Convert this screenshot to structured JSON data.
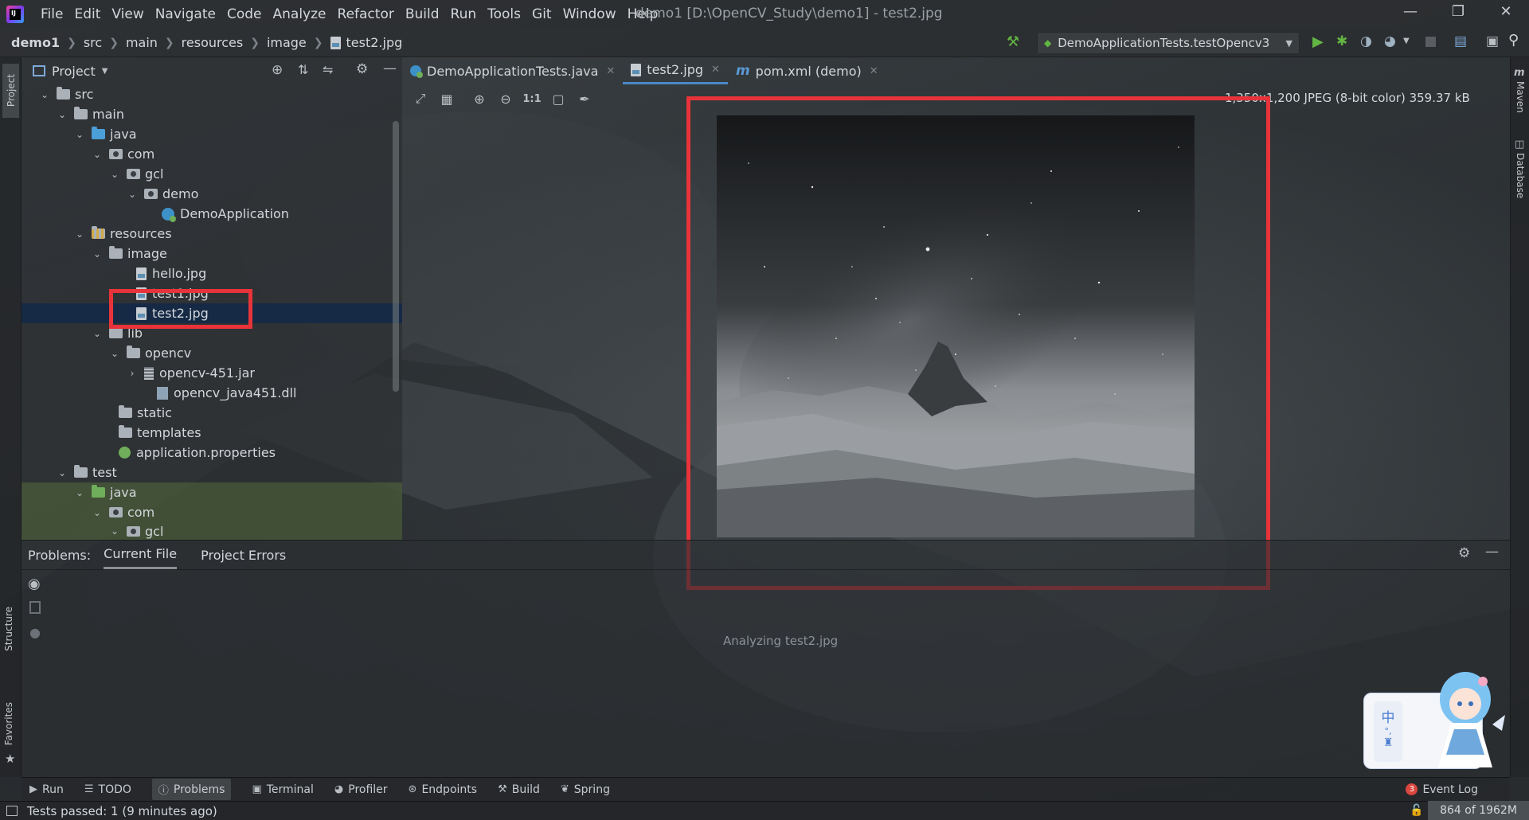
{
  "menubar": {
    "app_icon": "intellij-logo",
    "items": [
      "File",
      "Edit",
      "View",
      "Navigate",
      "Code",
      "Analyze",
      "Refactor",
      "Build",
      "Run",
      "Tools",
      "Git",
      "Window",
      "Help"
    ],
    "title": "demo1 [D:\\OpenCV_Study\\demo1] - test2.jpg"
  },
  "navbar": {
    "crumbs": [
      "demo1",
      "src",
      "main",
      "resources",
      "image",
      "test2.jpg"
    ],
    "run_config": "DemoApplicationTests.testOpencv3"
  },
  "left_stripe": {
    "project": "Project",
    "structure": "Structure",
    "favorites": "Favorites"
  },
  "right_stripe": {
    "maven": "Maven",
    "database": "Database"
  },
  "project_panel": {
    "title": "Project",
    "tree": [
      {
        "label": "src",
        "depth": 1,
        "expanded": true,
        "icon": "folder"
      },
      {
        "label": "main",
        "depth": 2,
        "expanded": true,
        "icon": "folder"
      },
      {
        "label": "java",
        "depth": 3,
        "expanded": true,
        "icon": "folder-blue"
      },
      {
        "label": "com",
        "depth": 4,
        "expanded": true,
        "icon": "package"
      },
      {
        "label": "gcl",
        "depth": 5,
        "expanded": true,
        "icon": "package"
      },
      {
        "label": "demo",
        "depth": 6,
        "expanded": true,
        "icon": "package"
      },
      {
        "label": "DemoApplication",
        "depth": 7,
        "icon": "class"
      },
      {
        "label": "resources",
        "depth": 3,
        "expanded": true,
        "icon": "folder-res"
      },
      {
        "label": "image",
        "depth": 4,
        "expanded": true,
        "icon": "folder"
      },
      {
        "label": "hello.jpg",
        "depth": 5,
        "icon": "image-file"
      },
      {
        "label": "test1.jpg",
        "depth": 5,
        "icon": "image-file"
      },
      {
        "label": "test2.jpg",
        "depth": 5,
        "icon": "image-file",
        "selected": true
      },
      {
        "label": "lib",
        "depth": 4,
        "expanded": true,
        "icon": "folder"
      },
      {
        "label": "opencv",
        "depth": 5,
        "expanded": true,
        "icon": "folder"
      },
      {
        "label": "opencv-451.jar",
        "depth": 6,
        "collapsed": true,
        "icon": "jar"
      },
      {
        "label": "opencv_java451.dll",
        "depth": 7,
        "icon": "dll"
      },
      {
        "label": "static",
        "depth": 4,
        "icon": "folder"
      },
      {
        "label": "templates",
        "depth": 4,
        "icon": "folder"
      },
      {
        "label": "application.properties",
        "depth": 4,
        "icon": "properties"
      },
      {
        "label": "test",
        "depth": 2,
        "expanded": true,
        "icon": "folder"
      },
      {
        "label": "java",
        "depth": 3,
        "expanded": true,
        "icon": "folder-green",
        "green": true
      },
      {
        "label": "com",
        "depth": 4,
        "expanded": true,
        "icon": "package",
        "green": true
      },
      {
        "label": "gcl",
        "depth": 5,
        "expanded": true,
        "icon": "package",
        "green": true
      }
    ]
  },
  "tabs": [
    {
      "label": "DemoApplicationTests.java",
      "icon": "class"
    },
    {
      "label": "test2.jpg",
      "icon": "image-file",
      "active": true
    },
    {
      "label": "pom.xml (demo)",
      "icon": "maven"
    }
  ],
  "image_viewer": {
    "info": "1,350x1,200 JPEG (8-bit color) 359.37 kB",
    "toolbar_icons": [
      "fit-icon",
      "grid-icon",
      "zoom-in-icon",
      "zoom-out-icon",
      "actual-size-icon",
      "background-icon",
      "color-picker-icon"
    ]
  },
  "problems": {
    "label": "Problems:",
    "tabs": [
      "Current File",
      "Project Errors"
    ],
    "active_tab": "Current File",
    "status": "Analyzing test2.jpg"
  },
  "bottom_tools": [
    "Run",
    "TODO",
    "Problems",
    "Terminal",
    "Profiler",
    "Endpoints",
    "Build",
    "Spring"
  ],
  "active_bottom_tool": "Problems",
  "event_log": {
    "count": "3",
    "label": "Event Log"
  },
  "status": {
    "message": "Tests passed: 1 (9 minutes ago)",
    "memory": "864 of 1962M"
  },
  "widget": {
    "ime_char": "中"
  },
  "colors": {
    "highlight_red": "#e8333a",
    "accent_blue": "#4a88c7",
    "selection": "#152946"
  }
}
